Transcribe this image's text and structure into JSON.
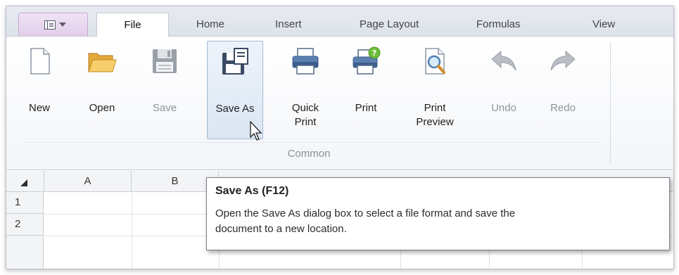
{
  "tabs": [
    {
      "label": "File",
      "active": true
    },
    {
      "label": "Home",
      "active": false
    },
    {
      "label": "Insert",
      "active": false
    },
    {
      "label": "Page Layout",
      "active": false
    },
    {
      "label": "Formulas",
      "active": false
    },
    {
      "label": "View",
      "active": false
    }
  ],
  "ribbon": {
    "group_label": "Common",
    "buttons": [
      {
        "label": "New",
        "icon": "new-document-icon",
        "enabled": true
      },
      {
        "label": "Open",
        "icon": "open-folder-icon",
        "enabled": true
      },
      {
        "label": "Save",
        "icon": "floppy-disk-icon",
        "enabled": false
      },
      {
        "label": "Save As",
        "icon": "save-as-icon",
        "enabled": true,
        "hovered": true
      },
      {
        "label": "Quick",
        "label2": "Print",
        "icon": "printer-icon",
        "enabled": true
      },
      {
        "label": "Print",
        "icon": "printer-help-icon",
        "enabled": true
      },
      {
        "label": "Print",
        "label2": "Preview",
        "icon": "print-preview-icon",
        "enabled": true
      },
      {
        "label": "Undo",
        "icon": "undo-arrow-icon",
        "enabled": false
      },
      {
        "label": "Redo",
        "icon": "redo-arrow-icon",
        "enabled": false
      }
    ]
  },
  "sheet": {
    "columns": [
      "A",
      "B"
    ],
    "rows": [
      "1",
      "2"
    ]
  },
  "tooltip": {
    "title": "Save As (F12)",
    "line1": "Open the Save As dialog box to select a file format and save the",
    "line2": "document to a new location."
  },
  "colors": {
    "app_menu": "#e2cde9",
    "hover_fill": "#dbe6f3",
    "disabled_text": "#8f949b"
  }
}
